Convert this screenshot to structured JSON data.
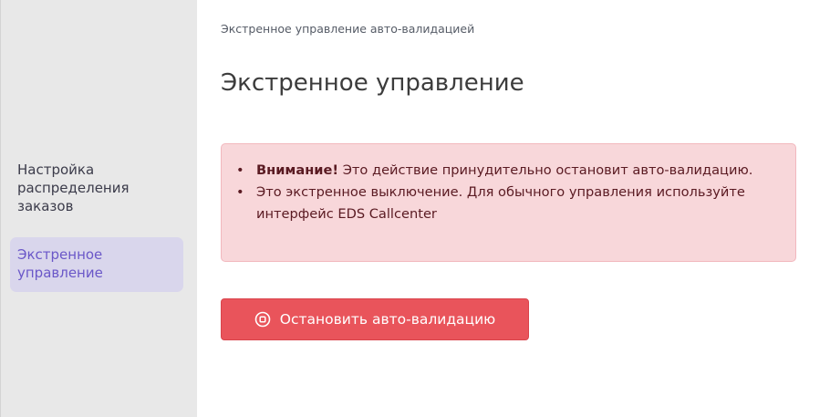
{
  "sidebar": {
    "items": [
      {
        "label": "Настройка распределения заказов",
        "active": false
      },
      {
        "label": "Экстренное управление",
        "active": true
      }
    ]
  },
  "breadcrumb": "Экстренное управление авто-валидацией",
  "page_title": "Экстренное управление",
  "alert": {
    "items": [
      {
        "strong": "Внимание!",
        "text": " Это действие принудительно остановит авто-валидацию."
      },
      {
        "strong": "",
        "text": "Это экстренное выключение. Для обычного управления используйте интерфейс EDS Callcenter"
      }
    ]
  },
  "stop_button": {
    "label": "Остановить авто-валидацию",
    "icon": "stop-circle-icon"
  },
  "colors": {
    "sidebar_bg": "#e8e8e8",
    "active_nav_bg": "#d9d6ec",
    "active_nav_text": "#6a57c8",
    "alert_bg": "#f8d7da",
    "alert_border": "#f2b8be",
    "danger_button": "#e9545b"
  }
}
